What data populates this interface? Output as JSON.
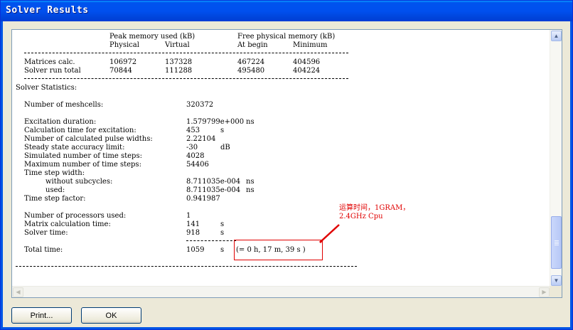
{
  "window": {
    "title": "Solver Results"
  },
  "memory_table": {
    "header1": {
      "peak": "Peak memory used (kB)",
      "free": "Free physical memory (kB)"
    },
    "header2": {
      "physical": "Physical",
      "virtual": "Virtual",
      "at_begin": "At begin",
      "minimum": "Minimum"
    },
    "rows": [
      {
        "label": "Matrices calc.",
        "physical": "106972",
        "virtual": "137328",
        "at_begin": "467224",
        "minimum": "404596"
      },
      {
        "label": "Solver run total",
        "physical": "70844",
        "virtual": "111288",
        "at_begin": "495480",
        "minimum": "404224"
      }
    ]
  },
  "stats": {
    "heading": "Solver Statistics:",
    "meshcells": {
      "label": "Number of meshcells:",
      "value": "320372"
    },
    "excitation_duration": {
      "label": "Excitation duration:",
      "value": "1.579799e+000",
      "unit": "ns"
    },
    "calc_time_excitation": {
      "label": "Calculation time for excitation:",
      "value": "453",
      "unit": "s"
    },
    "pulse_widths": {
      "label": "Number of calculated pulse widths:",
      "value": "2.22104"
    },
    "accuracy_limit": {
      "label": "Steady state accuracy limit:",
      "value": "-30",
      "unit": "dB"
    },
    "simulated_steps": {
      "label": "Simulated number of time steps:",
      "value": "4028"
    },
    "max_steps": {
      "label": "Maximum number of time steps:",
      "value": "54406"
    },
    "time_step_width": {
      "label": "Time step width:"
    },
    "without_subcycles": {
      "label": "without subcycles:",
      "value": "8.711035e-004",
      "unit": "ns"
    },
    "used": {
      "label": "used:",
      "value": "8.711035e-004",
      "unit": "ns"
    },
    "time_step_factor": {
      "label": "Time step factor:",
      "value": "0.941987"
    },
    "processors": {
      "label": "Number of processors used:",
      "value": "1"
    },
    "matrix_calc_time": {
      "label": "Matrix calculation time:",
      "value": "141",
      "unit": "s"
    },
    "solver_time": {
      "label": "Solver time:",
      "value": "918",
      "unit": "s"
    },
    "total_time": {
      "label": "Total time:",
      "value": "1059",
      "unit": "s",
      "breakdown": "(= 0 h, 17 m, 39 s )"
    }
  },
  "annotation": {
    "line1": "运算时间，1GRAM，",
    "line2": "2.4GHz Cpu",
    "color": "#e00000"
  },
  "buttons": {
    "print": "Print...",
    "ok": "OK"
  }
}
